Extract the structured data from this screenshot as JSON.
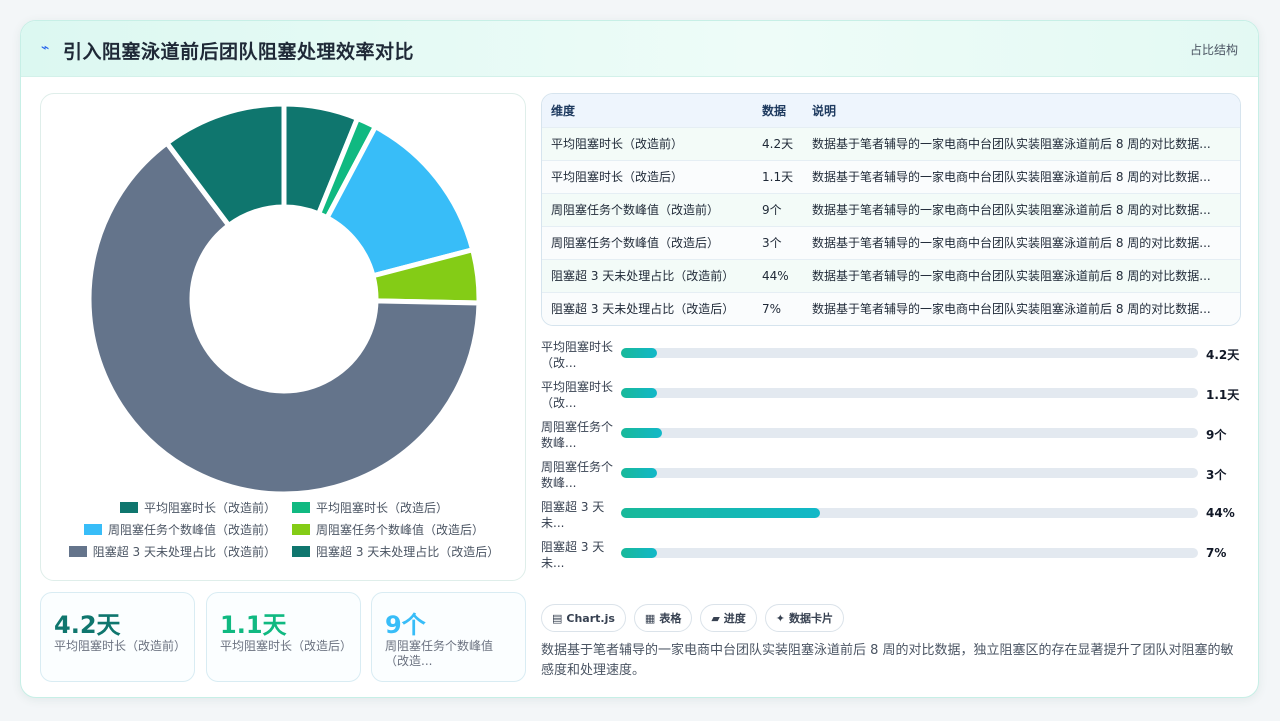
{
  "header": {
    "icon": "lightning-icon",
    "title": "引入阻塞泳道前后团队阻塞处理效率对比",
    "right_label": "占比结构"
  },
  "chart_data": {
    "type": "pie",
    "donut": true,
    "categories": [
      "平均阻塞时长（改造前）",
      "平均阻塞时长（改造后）",
      "周阻塞任务个数峰值（改造前）",
      "周阻塞任务个数峰值（改造后）",
      "阻塞超 3 天未处理占比（改造前）",
      "阻塞超 3 天未处理占比（改造后）"
    ],
    "values": [
      4.2,
      1.1,
      9,
      3,
      44,
      7
    ],
    "colors": [
      "#0f766e",
      "#10b981",
      "#38bdf8",
      "#84cc16",
      "#64748b",
      "#0f766e"
    ],
    "legend": "bottom"
  },
  "legend_items": [
    {
      "label": "平均阻塞时长（改造前）",
      "color": "#0f766e"
    },
    {
      "label": "平均阻塞时长（改造后）",
      "color": "#10b981"
    },
    {
      "label": "周阻塞任务个数峰值（改造前）",
      "color": "#38bdf8"
    },
    {
      "label": "周阻塞任务个数峰值（改造后）",
      "color": "#84cc16"
    },
    {
      "label": "阻塞超 3 天未处理占比（改造前）",
      "color": "#64748b"
    },
    {
      "label": "阻塞超 3 天未处理占比（改造后）",
      "color": "#0f766e"
    }
  ],
  "kpis": [
    {
      "value": "4.2天",
      "label": "平均阻塞时长（改造前）",
      "color": "#0f766e"
    },
    {
      "value": "1.1天",
      "label": "平均阻塞时长（改造后）",
      "color": "#10b981"
    },
    {
      "value": "9个",
      "label": "周阻塞任务个数峰值（改造...",
      "color": "#38bdf8"
    }
  ],
  "table": {
    "headers": [
      "维度",
      "数据",
      "说明"
    ],
    "rows": [
      [
        "平均阻塞时长（改造前）",
        "4.2天",
        "数据基于笔者辅导的一家电商中台团队实装阻塞泳道前后 8 周的对比数据..."
      ],
      [
        "平均阻塞时长（改造后）",
        "1.1天",
        "数据基于笔者辅导的一家电商中台团队实装阻塞泳道前后 8 周的对比数据..."
      ],
      [
        "周阻塞任务个数峰值（改造前）",
        "9个",
        "数据基于笔者辅导的一家电商中台团队实装阻塞泳道前后 8 周的对比数据..."
      ],
      [
        "周阻塞任务个数峰值（改造后）",
        "3个",
        "数据基于笔者辅导的一家电商中台团队实装阻塞泳道前后 8 周的对比数据..."
      ],
      [
        "阻塞超 3 天未处理占比（改造前）",
        "44%",
        "数据基于笔者辅导的一家电商中台团队实装阻塞泳道前后 8 周的对比数据..."
      ],
      [
        "阻塞超 3 天未处理占比（改造后）",
        "7%",
        "数据基于笔者辅导的一家电商中台团队实装阻塞泳道前后 8 周的对比数据..."
      ]
    ]
  },
  "progress": [
    {
      "label": "平均阻塞时长（改...",
      "value": "4.2天",
      "fraction": 0.0618
    },
    {
      "label": "平均阻塞时长（改...",
      "value": "1.1天",
      "fraction": 0.0618
    },
    {
      "label": "周阻塞任务个数峰...",
      "value": "9个",
      "fraction": 0.0705
    },
    {
      "label": "周阻塞任务个数峰...",
      "value": "3个",
      "fraction": 0.0618
    },
    {
      "label": "阻塞超 3 天未...",
      "value": "44%",
      "fraction": 0.345
    },
    {
      "label": "阻塞超 3 天未...",
      "value": "7%",
      "fraction": 0.0618
    }
  ],
  "chips": [
    {
      "icon": "chart-icon",
      "glyph": "▤",
      "label": "Chart.js"
    },
    {
      "icon": "table-icon",
      "glyph": "▦",
      "label": "表格"
    },
    {
      "icon": "progress-icon",
      "glyph": "▰",
      "label": "进度"
    },
    {
      "icon": "sparkle-icon",
      "glyph": "✦",
      "label": "数据卡片"
    }
  ],
  "note": "数据基于笔者辅导的一家电商中台团队实装阻塞泳道前后 8 周的对比数据，独立阻塞区的存在显著提升了团队对阻塞的敏感度和处理速度。"
}
